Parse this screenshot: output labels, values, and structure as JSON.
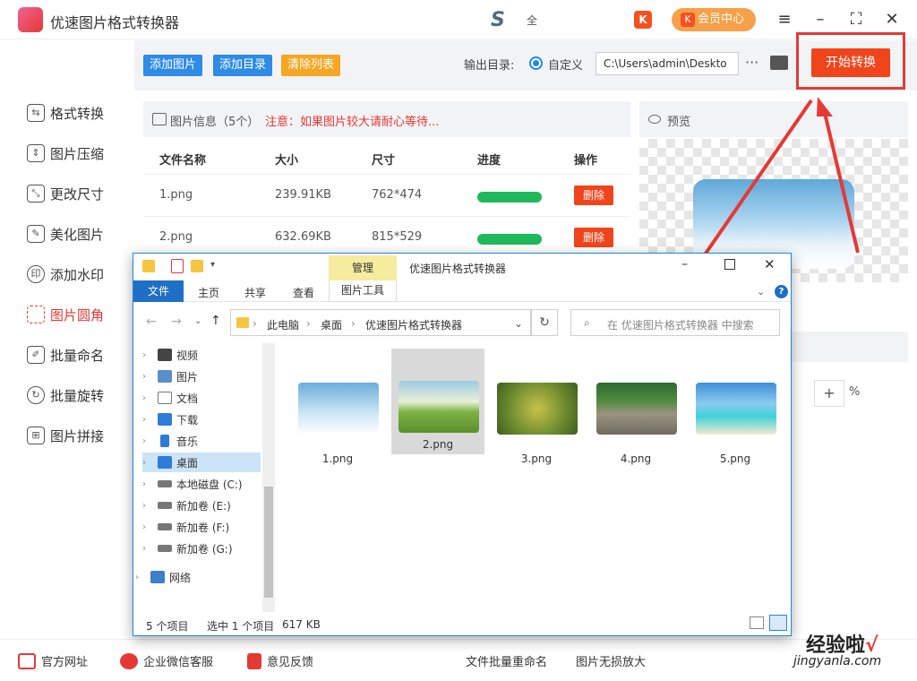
{
  "app": {
    "title": "优速图片格式转换器",
    "brand_sub": "全",
    "vip_label": "会员中心"
  },
  "sidebar": {
    "items": [
      {
        "label": "格式转换",
        "icon": "swap-icon"
      },
      {
        "label": "图片压缩",
        "icon": "compress-icon"
      },
      {
        "label": "更改尺寸",
        "icon": "resize-icon"
      },
      {
        "label": "美化图片",
        "icon": "beautify-icon"
      },
      {
        "label": "添加水印",
        "icon": "watermark-icon"
      },
      {
        "label": "图片圆角",
        "icon": "round-corner-icon",
        "active": true
      },
      {
        "label": "批量命名",
        "icon": "rename-icon"
      },
      {
        "label": "批量旋转",
        "icon": "rotate-icon"
      },
      {
        "label": "图片拼接",
        "icon": "stitch-icon"
      }
    ]
  },
  "toolbar": {
    "add_images": "添加图片",
    "add_dir": "添加目录",
    "clear_list": "清除列表",
    "output_label": "输出目录:",
    "radio_label": "自定义",
    "output_path": "C:\\Users\\admin\\Deskto",
    "more": "···",
    "start": "开始转换",
    "colors": {
      "add": "#2e8be6",
      "clear": "#f5a623",
      "start": "#f0441b"
    }
  },
  "info": {
    "title": "图片信息（5个）",
    "note": "注意：如果图片较大请耐心等待...",
    "columns": [
      "文件名称",
      "大小",
      "尺寸",
      "进度",
      "操作"
    ],
    "rows": [
      {
        "name": "1.png",
        "size": "239.91KB",
        "dims": "762*474",
        "progress": 1.0,
        "action": "删除"
      },
      {
        "name": "2.png",
        "size": "632.69KB",
        "dims": "815*529",
        "progress": 1.0,
        "action": "删除"
      }
    ]
  },
  "preview": {
    "title": "预览",
    "zoom_plus": "+",
    "zoom_unit": "%"
  },
  "footer": {
    "items": [
      "官方网址",
      "企业微信客服",
      "意见反馈",
      "文件批量重命名",
      "图片无损放大"
    ]
  },
  "watermark": {
    "main": "经验啦",
    "check": "√",
    "sub": "jingyanla.com"
  },
  "explorer": {
    "manage": "管理",
    "title": "优速图片格式转换器",
    "tabs": [
      "文件",
      "主页",
      "共享",
      "查看",
      "图片工具"
    ],
    "crumbs": [
      "此电脑",
      "桌面",
      "优速图片格式转换器"
    ],
    "search_placeholder": "在 优速图片格式转换器 中搜索",
    "nav": [
      {
        "label": "视频",
        "icon": "video-icon"
      },
      {
        "label": "图片",
        "icon": "pictures-icon"
      },
      {
        "label": "文档",
        "icon": "documents-icon"
      },
      {
        "label": "下载",
        "icon": "download-icon"
      },
      {
        "label": "音乐",
        "icon": "music-icon"
      },
      {
        "label": "桌面",
        "icon": "desktop-icon",
        "selected": true
      },
      {
        "label": "本地磁盘 (C:)",
        "icon": "drive-icon"
      },
      {
        "label": "新加卷 (E:)",
        "icon": "drive-icon"
      },
      {
        "label": "新加卷 (F:)",
        "icon": "drive-icon"
      },
      {
        "label": "新加卷 (G:)",
        "icon": "drive-icon"
      },
      {
        "label": "网络",
        "icon": "network-icon"
      }
    ],
    "files": [
      "1.png",
      "2.png",
      "3.png",
      "4.png",
      "5.png"
    ],
    "status": {
      "count": "5 个项目",
      "selected": "选中 1 个项目",
      "size": "617 KB"
    }
  }
}
